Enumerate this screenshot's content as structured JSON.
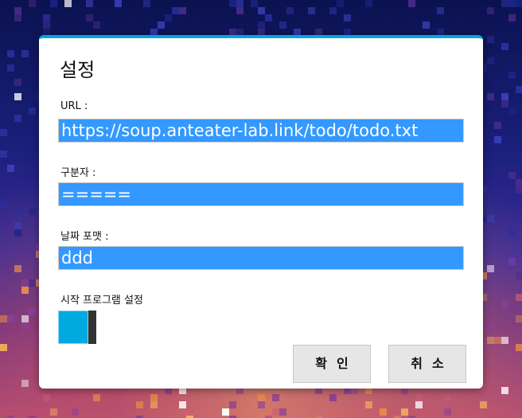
{
  "dialog": {
    "title": "설정",
    "url": {
      "label": "URL :",
      "value": "https://soup.anteater-lab.link/todo/todo.txt"
    },
    "separator": {
      "label": "구분자 :",
      "value": "====="
    },
    "date_format": {
      "label": "날짜 포맷 :",
      "value": "ddd"
    },
    "startup": {
      "label": "시작 프로그램 설정",
      "enabled": true
    },
    "ok_label": "확인",
    "cancel_label": "취소"
  },
  "colors": {
    "accent": "#00a6df",
    "field_selection": "#3399ff",
    "toggle_on": "#00a9e0",
    "button_bg": "#e6e6e6"
  }
}
